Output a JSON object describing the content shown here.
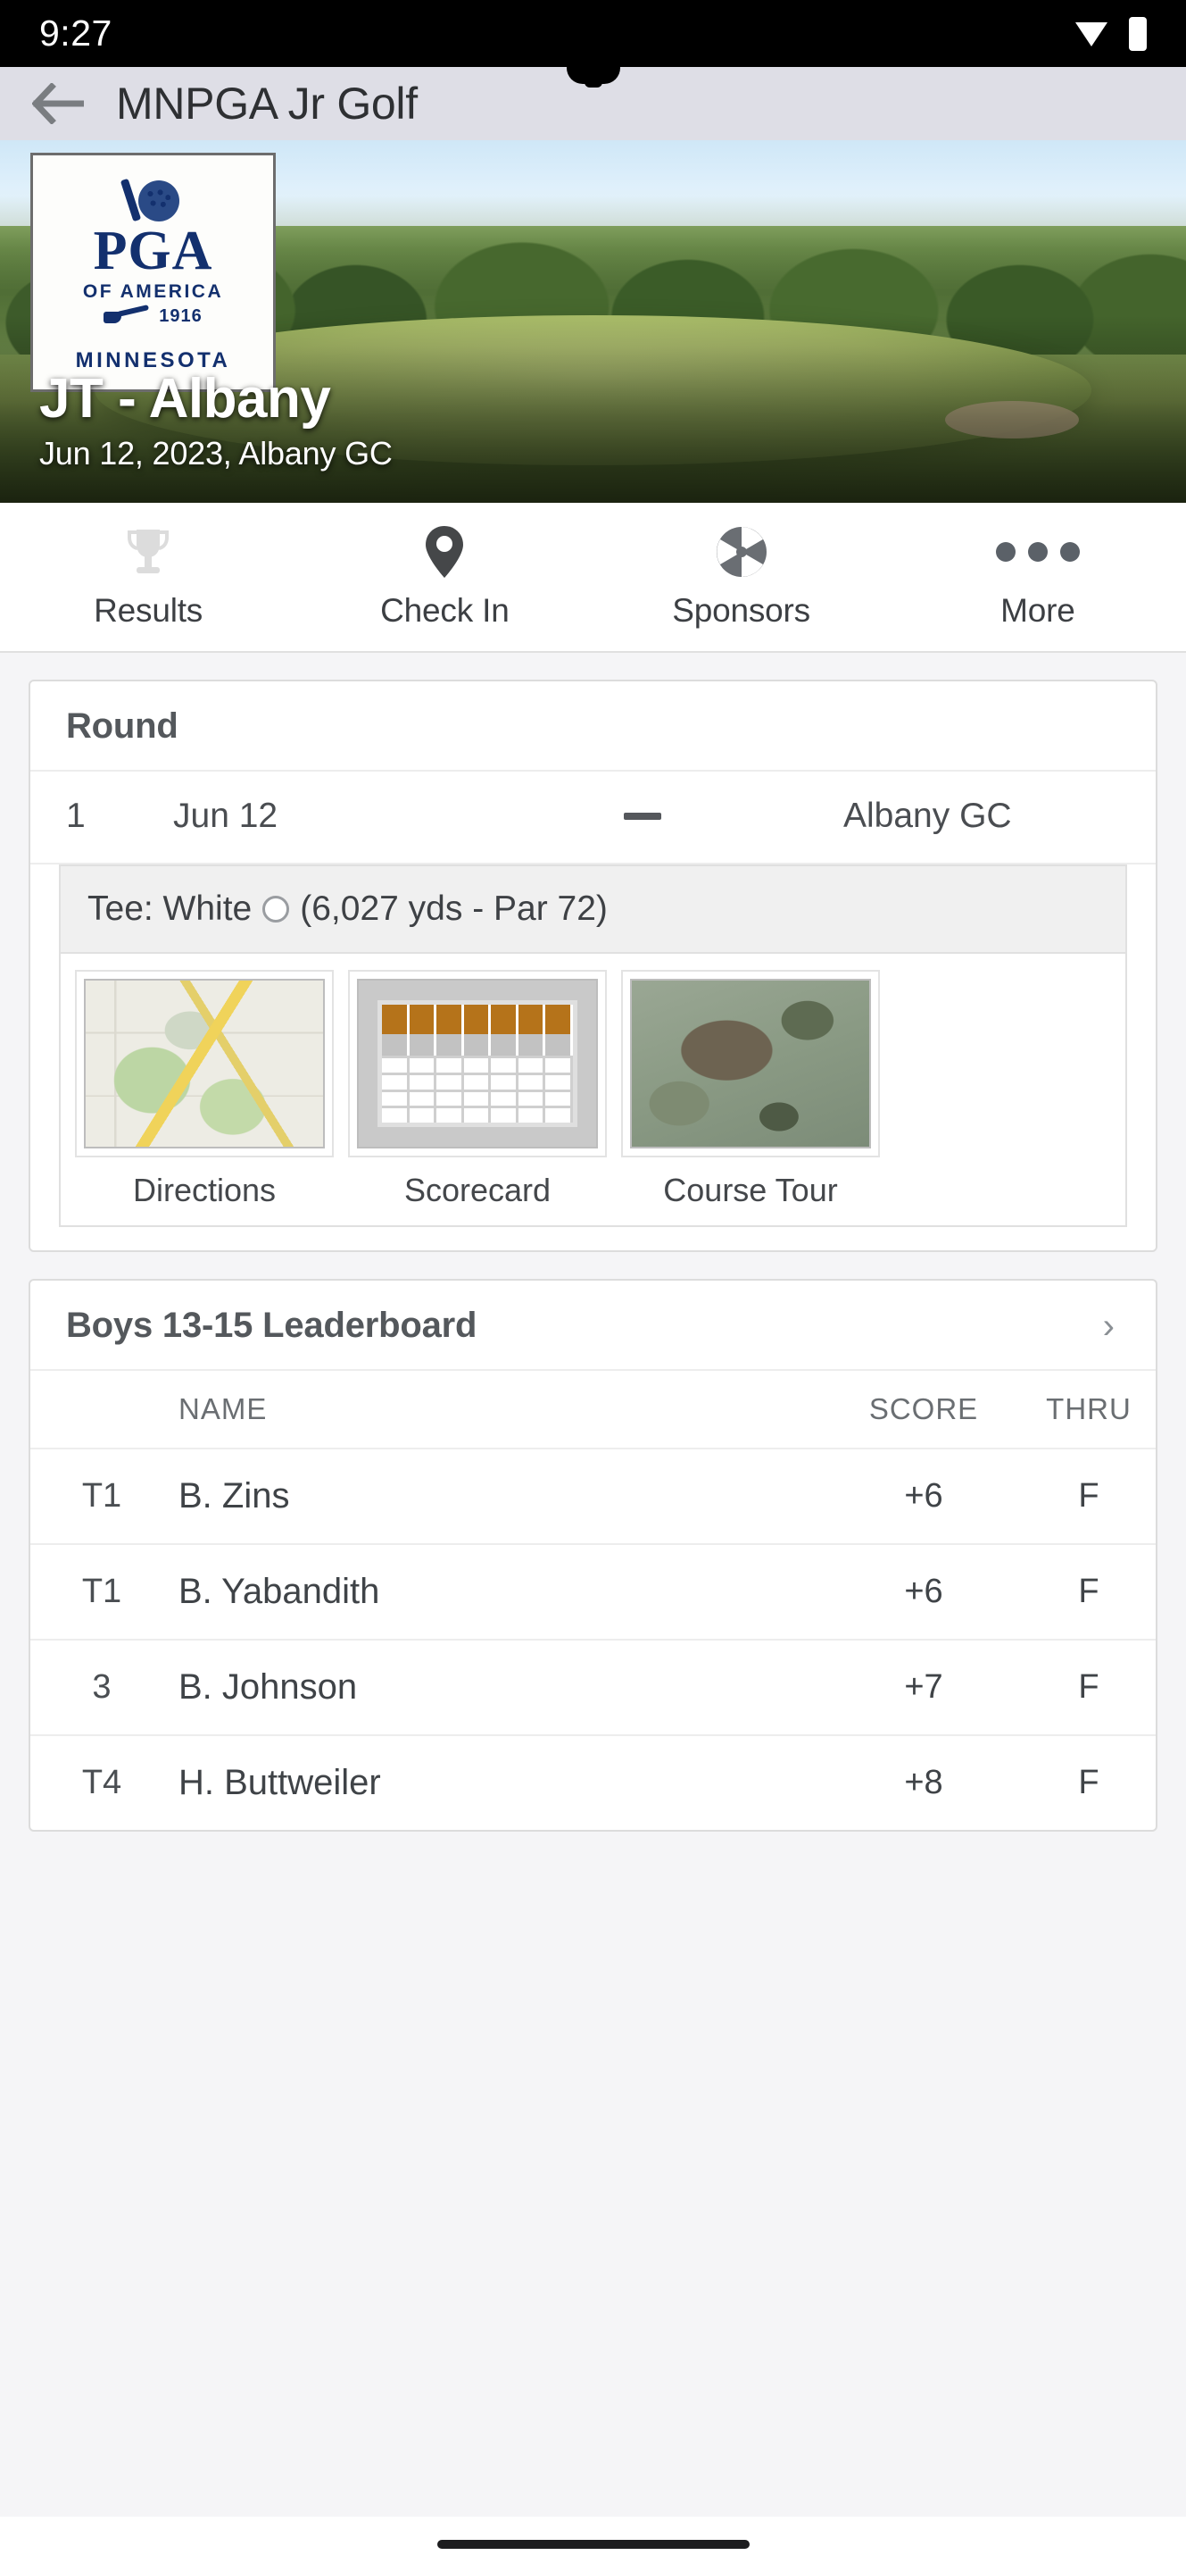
{
  "status_bar": {
    "time": "9:27",
    "icons": [
      "wifi-icon",
      "battery-icon"
    ]
  },
  "app_bar": {
    "back_icon": "back-arrow-icon",
    "title": "MNPGA Jr Golf"
  },
  "hero": {
    "logo": {
      "brand": "PGA",
      "of_america": "OF AMERICA",
      "founded": "1916",
      "chapter": "MINNESOTA"
    },
    "title": "JT - Albany",
    "subtitle": "Jun 12, 2023, Albany GC"
  },
  "tabs": [
    {
      "label": "Results",
      "icon": "trophy-icon"
    },
    {
      "label": "Check In",
      "icon": "map-pin-icon"
    },
    {
      "label": "Sponsors",
      "icon": "aperture-icon"
    },
    {
      "label": "More",
      "icon": "ellipsis-icon"
    }
  ],
  "round_card": {
    "title": "Round",
    "row": {
      "number": "1",
      "date": "Jun 12",
      "separator": "—",
      "course": "Albany GC"
    },
    "tee": {
      "label": "Tee: White",
      "marker": "white-tee-circle-icon",
      "details": "(6,027 yds - Par 72)"
    },
    "tiles": [
      {
        "label": "Directions",
        "icon": "map-thumbnail"
      },
      {
        "label": "Scorecard",
        "icon": "scorecard-thumbnail"
      },
      {
        "label": "Course Tour",
        "icon": "aerial-course-thumbnail"
      }
    ]
  },
  "leaderboard": {
    "title": "Boys 13-15 Leaderboard",
    "chevron": "›",
    "columns": {
      "pos": "",
      "name": "NAME",
      "score": "SCORE",
      "thru": "THRU"
    },
    "rows": [
      {
        "pos": "T1",
        "name": "B. Zins",
        "score": "+6",
        "thru": "F"
      },
      {
        "pos": "T1",
        "name": "B. Yabandith",
        "score": "+6",
        "thru": "F"
      },
      {
        "pos": "3",
        "name": "B. Johnson",
        "score": "+7",
        "thru": "F"
      },
      {
        "pos": "T4",
        "name": "H. Buttweiler",
        "score": "+8",
        "thru": "F"
      }
    ]
  },
  "colors": {
    "appbar_bg": "#dedee6",
    "brand_navy": "#13306e",
    "scorecard_orange": "#b5731a",
    "text_primary": "#3f4347",
    "text_muted": "#6a6e72"
  }
}
